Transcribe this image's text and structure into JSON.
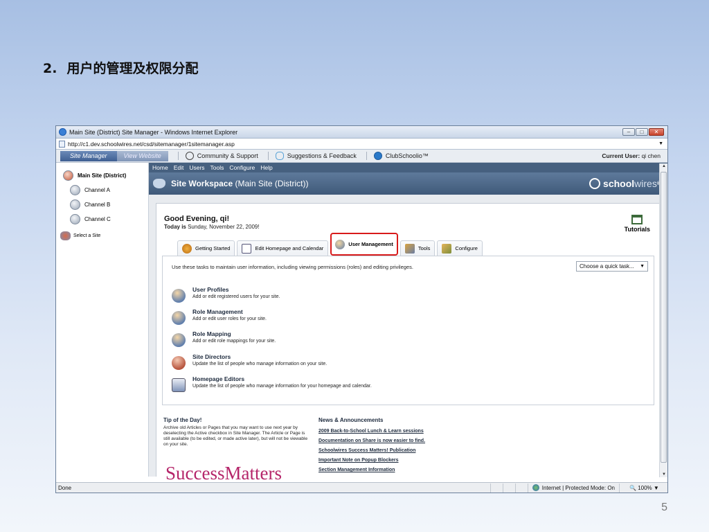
{
  "slide": {
    "number_prefix": "2.",
    "title": "用户的管理及权限分配",
    "page_number": "5"
  },
  "browser": {
    "window_title": "Main Site (District) Site Manager - Windows Internet Explorer",
    "url": "http://c1.dev.schoolwires.net/csd/sitemanager/1sitemanager.asp",
    "status": "Done",
    "zone": "Internet | Protected Mode: On",
    "zoom": "100%"
  },
  "topbar": {
    "site_manager_tab": "Site Manager",
    "view_website_tab": "View Website",
    "links": [
      "Community & Support",
      "Suggestions & Feedback",
      "ClubSchoolio™"
    ],
    "current_user_label": "Current User:",
    "current_user": "qi chen"
  },
  "sidebar": {
    "main_site": "Main Site (District)",
    "channels": [
      "Channel A",
      "Channel B",
      "Channel C"
    ],
    "select_site": "Select a Site"
  },
  "menu": [
    "Home",
    "Edit",
    "Users",
    "Tools",
    "Configure",
    "Help"
  ],
  "banner": {
    "title": "Site Workspace",
    "subtitle": "(Main Site (District))",
    "logo_bold": "school",
    "logo_lite": "wires",
    "logo_mark": "®"
  },
  "greeting": {
    "text": "Good Evening, qi!",
    "today_label": "Today is",
    "date": "Sunday, November 22, 2009!"
  },
  "tutorials": "Tutorials",
  "tabs": [
    "Getting Started",
    "Edit Homepage and Calendar",
    "User Management",
    "Tools",
    "Configure"
  ],
  "user_management": {
    "description": "Use these tasks to maintain user information, including viewing permissions (roles) and editing privileges.",
    "quick_task": "Choose a quick task...",
    "tasks": [
      {
        "title": "User Profiles",
        "desc": "Add or edit registered users for your site."
      },
      {
        "title": "Role Management",
        "desc": "Add or edit user roles for your site."
      },
      {
        "title": "Role Mapping",
        "desc": "Add or edit role mappings for your site."
      },
      {
        "title": "Site Directors",
        "desc": "Update the list of people who manage information on your site."
      },
      {
        "title": "Homepage Editors",
        "desc": "Update the list of people who manage information for your homepage and calendar."
      }
    ]
  },
  "tip": {
    "heading": "Tip of the Day!",
    "text": "Archive old Articles or Pages that you may want to use next year by deselecting the Active checkbox in Site Manager. The Article or Page is still available (to be edited, or made active later), but will not be viewable on your site.",
    "logo_text": "SuccessMatters"
  },
  "news": {
    "heading": "News & Announcements",
    "items": [
      "2009 Back-to-School Lunch & Learn sessions",
      "Documentation on Share is now easier to find.",
      "Schoolwires Success Matters! Publication",
      "Important Note on Popup Blockers",
      "Section Management Information"
    ]
  }
}
